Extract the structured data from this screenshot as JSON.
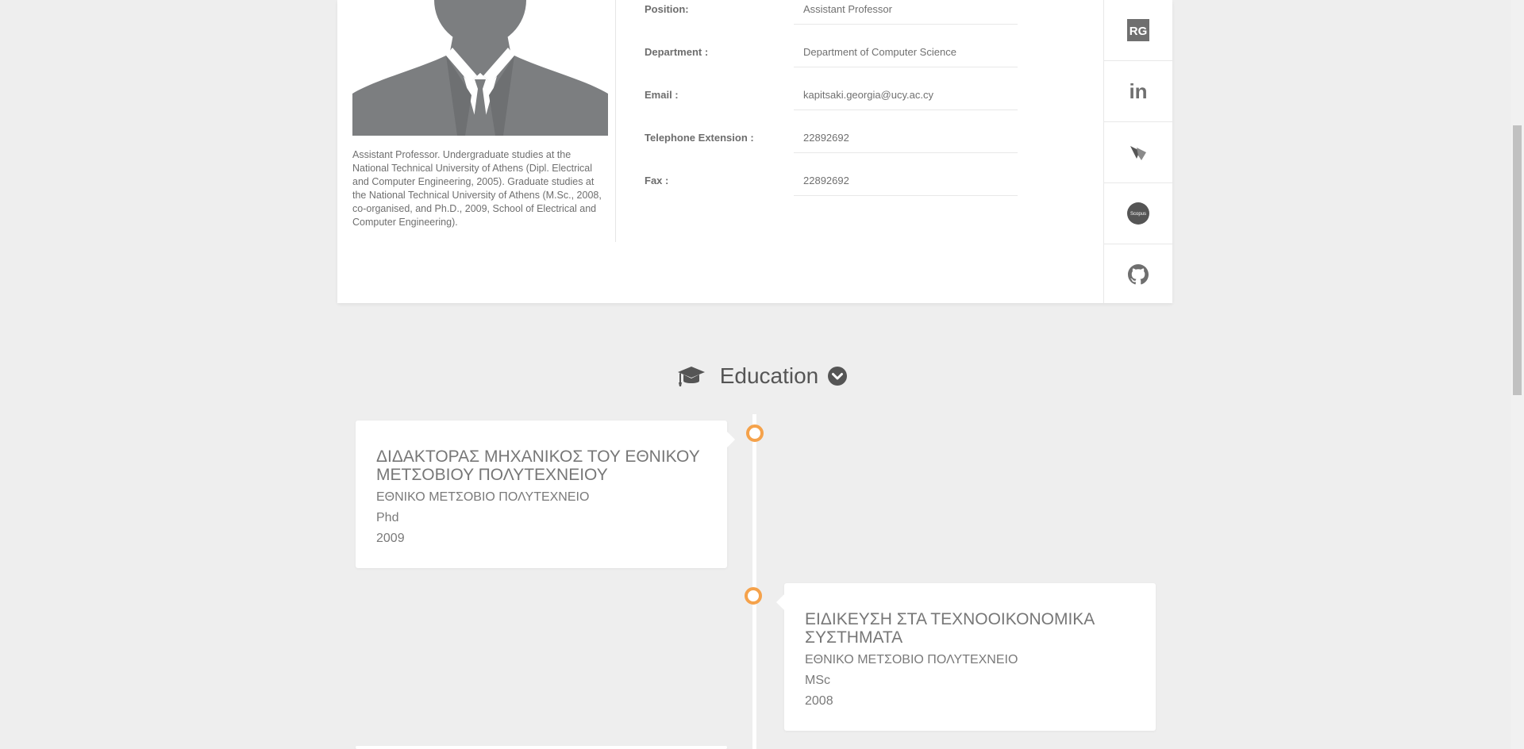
{
  "profile": {
    "bio": "Assistant Professor. Undergraduate studies at the National Technical University of Athens (Dipl. Electrical and Computer Engineering, 2005). Graduate studies at the National Technical University of Athens (M.Sc., 2008, co-organised, and Ph.D., 2009, School of Electrical and Computer Engineering).",
    "fields": [
      {
        "label": "Position:",
        "value": "Assistant Professor"
      },
      {
        "label": "Department :",
        "value": "Department of Computer Science"
      },
      {
        "label": "Email :",
        "value": "kapitsaki.georgia@ucy.ac.cy"
      },
      {
        "label": "Telephone Extension :",
        "value": "22892692"
      },
      {
        "label": "Fax :",
        "value": "22892692"
      }
    ],
    "social": [
      {
        "icon": "researchgate-icon",
        "text": "RG"
      },
      {
        "icon": "linkedin-icon",
        "text": "in"
      },
      {
        "icon": "orcid-icon"
      },
      {
        "icon": "scopus-icon",
        "text": "Scopus"
      },
      {
        "icon": "github-icon"
      }
    ]
  },
  "education": {
    "heading": "Education",
    "items": [
      {
        "title": "ΔΙΔΑΚΤΟΡΑΣ ΜΗΧΑΝΙΚΟΣ ΤΟΥ ΕΘΝΙΚΟΥ ΜΕΤΣΟΒΙΟΥ ΠΟΛΥΤΕΧΝΕΙΟΥ",
        "institution": "ΕΘΝΙΚΟ ΜΕΤΣΟΒΙΟ ΠΟΛΥΤΕΧΝΕΙΟ",
        "degree": "Phd",
        "year": "2009"
      },
      {
        "title": "ΕΙΔΙΚΕΥΣΗ ΣΤΑ ΤΕΧΝΟΟΙΚΟΝΟΜΙΚΑ ΣΥΣΤΗΜΑΤΑ",
        "institution": "ΕΘΝΙΚΟ ΜΕΤΣΟΒΙΟ ΠΟΛΥΤΕΧΝΕΙΟ",
        "degree": "MSc",
        "year": "2008"
      }
    ]
  },
  "colors": {
    "background": "#eeeeee",
    "card": "#ffffff",
    "timeline_dot": "#f5a24b",
    "text": "#666666"
  }
}
